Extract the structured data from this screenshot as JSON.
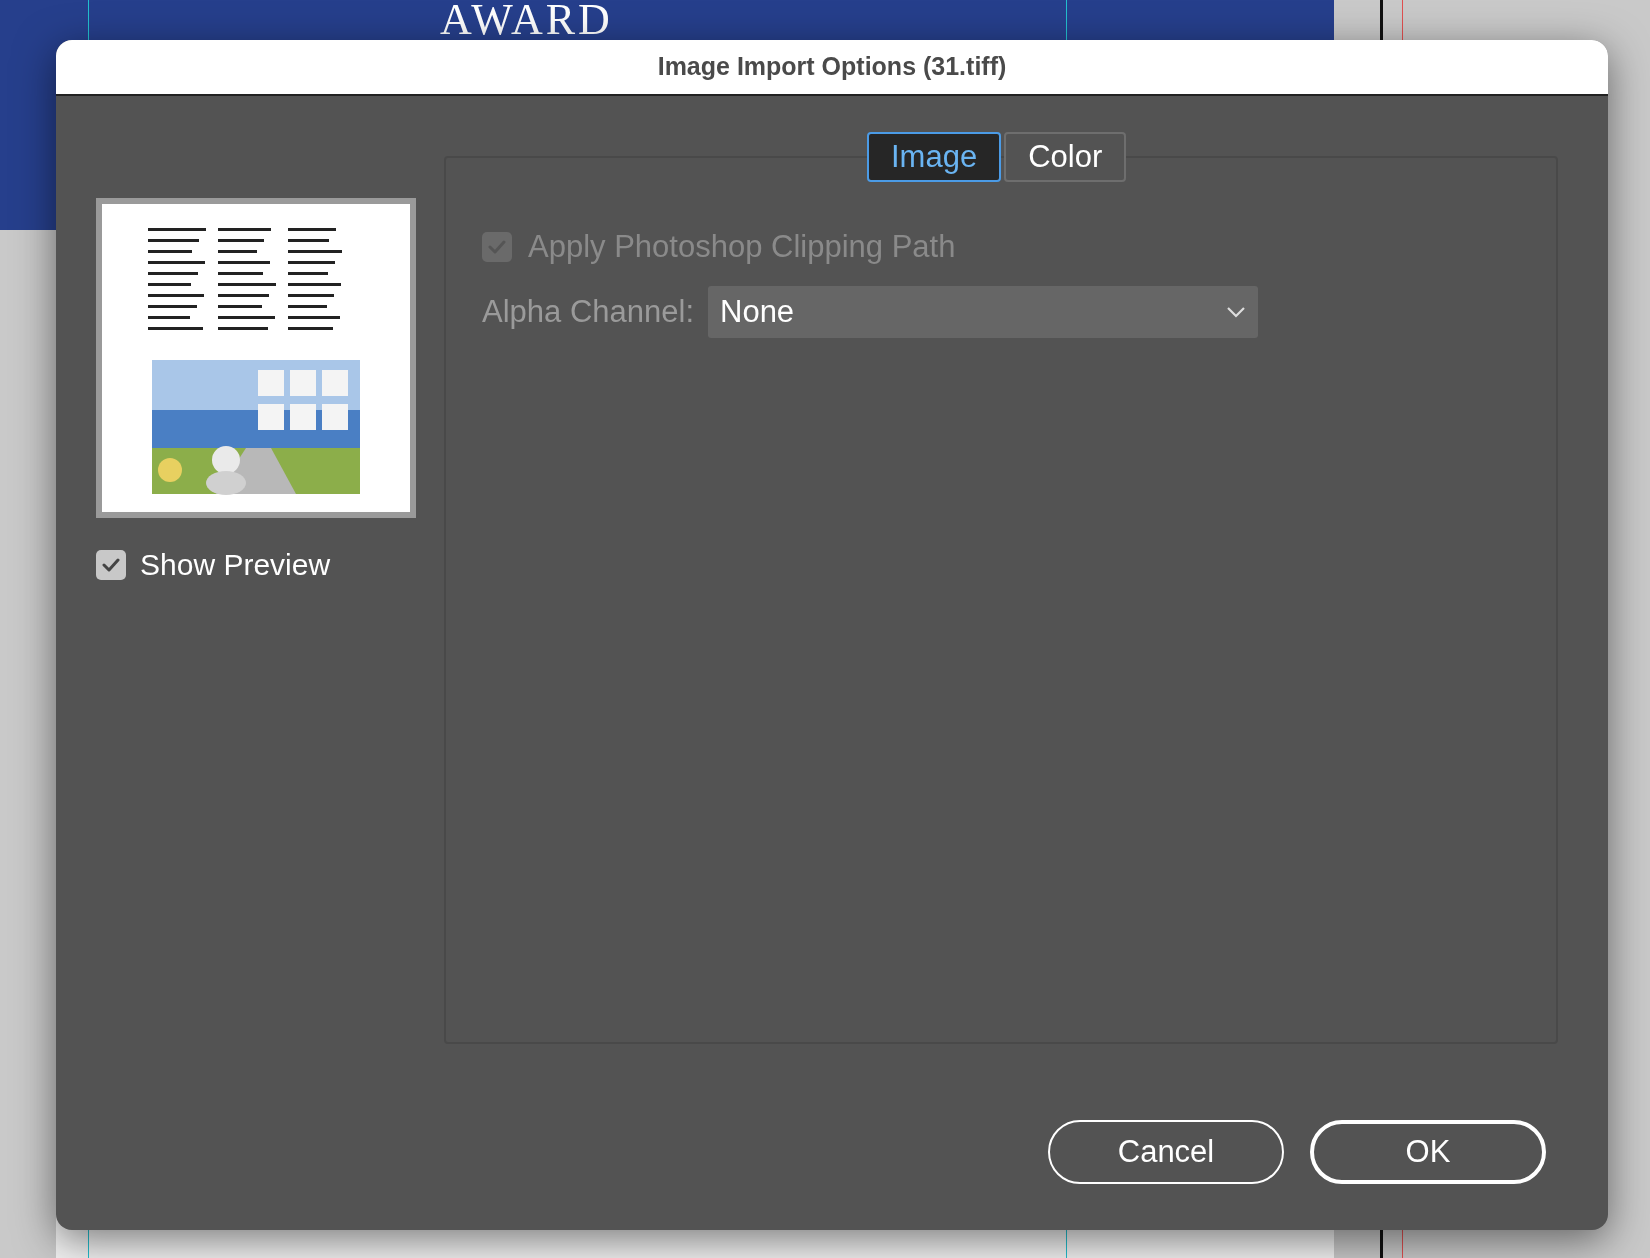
{
  "background": {
    "heading": "AWARD"
  },
  "dialog": {
    "title": "Image Import Options (31.tiff)",
    "show_preview": {
      "label": "Show Preview",
      "checked": true
    },
    "tabs": [
      {
        "label": "Image",
        "selected": true
      },
      {
        "label": "Color",
        "selected": false
      }
    ],
    "clip_path": {
      "label": "Apply Photoshop Clipping Path",
      "checked": true,
      "disabled": true
    },
    "alpha_channel": {
      "label": "Alpha Channel:",
      "value": "None"
    },
    "buttons": [
      {
        "label": "Cancel",
        "default": false
      },
      {
        "label": "OK",
        "default": true
      }
    ]
  }
}
